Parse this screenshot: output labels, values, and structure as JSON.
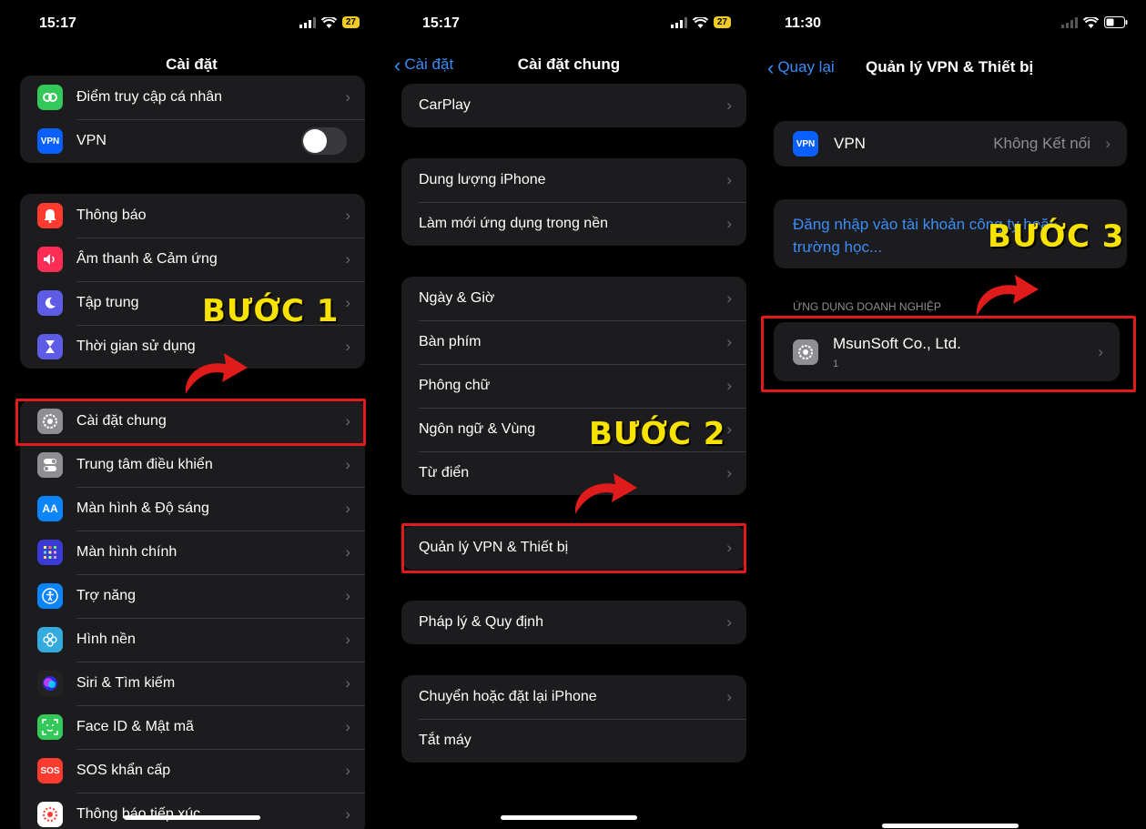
{
  "colors": {
    "accent": "#3a8df7",
    "highlight": "#e01b1b",
    "step_text": "#f7e200"
  },
  "p1": {
    "time": "15:17",
    "battery": "27",
    "title": "Cài đặt",
    "g1": [
      {
        "label": "Điểm truy cập cá nhân",
        "icon": "hotspot-icon",
        "color": "#34c759"
      },
      {
        "label": "VPN",
        "icon": "vpn-icon",
        "color": "#0a60ff",
        "icon_text": "VPN"
      }
    ],
    "g2": [
      {
        "label": "Thông báo",
        "icon": "bell-icon",
        "color": "#ff3b30"
      },
      {
        "label": "Âm thanh & Cảm ứng",
        "icon": "speaker-icon",
        "color": "#ff2d55"
      },
      {
        "label": "Tập trung",
        "icon": "moon-icon",
        "color": "#5e5ce6"
      },
      {
        "label": "Thời gian sử dụng",
        "icon": "hourglass-icon",
        "color": "#5e5ce6"
      }
    ],
    "g3": [
      {
        "label": "Cài đặt chung",
        "icon": "gear-icon",
        "color": "#8e8e93"
      },
      {
        "label": "Trung tâm điều khiển",
        "icon": "control-center-icon",
        "color": "#8e8e93"
      },
      {
        "label": "Màn hình & Độ sáng",
        "icon": "display-icon",
        "color": "#0a84ff",
        "icon_text": "AA"
      },
      {
        "label": "Màn hình chính",
        "icon": "home-screen-icon",
        "color": "#3a3ad6"
      },
      {
        "label": "Trợ năng",
        "icon": "accessibility-icon",
        "color": "#0a84ff"
      },
      {
        "label": "Hình nền",
        "icon": "wallpaper-icon",
        "color": "#35aadc"
      },
      {
        "label": "Siri & Tìm kiếm",
        "icon": "siri-icon",
        "color": "#222"
      },
      {
        "label": "Face ID & Mật mã",
        "icon": "faceid-icon",
        "color": "#34c759"
      },
      {
        "label": "SOS khẩn cấp",
        "icon": "sos-icon",
        "color": "#ff3b30",
        "icon_text": "SOS"
      },
      {
        "label": "Thông báo tiếp xúc",
        "icon": "exposure-icon",
        "color": "#fff"
      }
    ],
    "step": "BƯỚC 1"
  },
  "p2": {
    "time": "15:17",
    "battery": "27",
    "back": "Cài đặt",
    "title": "Cài đặt chung",
    "g1": [
      "CarPlay"
    ],
    "g2": [
      "Dung lượng iPhone",
      "Làm mới ứng dụng trong nền"
    ],
    "g3": [
      "Ngày & Giờ",
      "Bàn phím",
      "Phông chữ",
      "Ngôn ngữ & Vùng",
      "Từ điển"
    ],
    "g4": [
      "Quản lý VPN & Thiết bị"
    ],
    "g5": [
      "Pháp lý & Quy định"
    ],
    "g6": [
      "Chuyển hoặc đặt lại iPhone"
    ],
    "shutdown": "Tắt máy",
    "step": "BƯỚC 2"
  },
  "p3": {
    "time": "11:30",
    "back": "Quay lại",
    "title": "Quản lý VPN & Thiết bị",
    "vpn_label": "VPN",
    "vpn_icon_text": "VPN",
    "vpn_status": "Không Kết nối",
    "login_text": "Đăng nhập vào tài khoản công ty hoặc trường học...",
    "section_header": "ỨNG DỤNG DOANH NGHIỆP",
    "app_name": "MsunSoft Co., Ltd.",
    "app_count": "1",
    "step": "BƯỚC 3"
  }
}
